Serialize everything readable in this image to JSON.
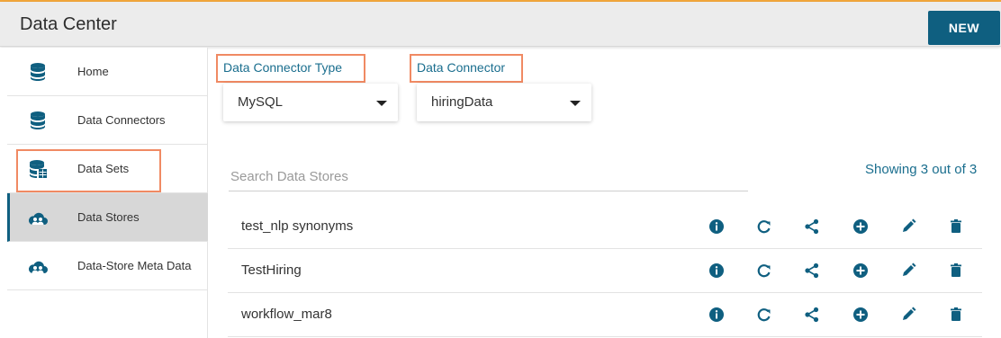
{
  "header": {
    "title": "Data Center",
    "new_button": "NEW",
    "accent_color": "#0f5f80",
    "top_border_color": "#f3a73b"
  },
  "sidebar": {
    "items": [
      {
        "label": "Home",
        "icon": "database-icon"
      },
      {
        "label": "Data Connectors",
        "icon": "database-icon"
      },
      {
        "label": "Data Sets",
        "icon": "database-table-icon"
      },
      {
        "label": "Data Stores",
        "icon": "cloud-users-icon",
        "active": true
      },
      {
        "label": "Data-Store Meta Data",
        "icon": "cloud-users-icon"
      }
    ]
  },
  "filters": {
    "connector_type_label": "Data Connector Type",
    "connector_type_value": "MySQL",
    "connector_label": "Data Connector",
    "connector_value": "hiringData",
    "highlight_color": "#f08a63"
  },
  "search": {
    "placeholder": "Search Data Stores",
    "showing": "Showing 3 out of 3"
  },
  "rows": [
    {
      "name": "test_nlp synonyms"
    },
    {
      "name": "TestHiring"
    },
    {
      "name": "workflow_mar8"
    }
  ],
  "row_actions": [
    "info-icon",
    "refresh-icon",
    "share-icon",
    "add-icon",
    "edit-icon",
    "delete-icon"
  ]
}
